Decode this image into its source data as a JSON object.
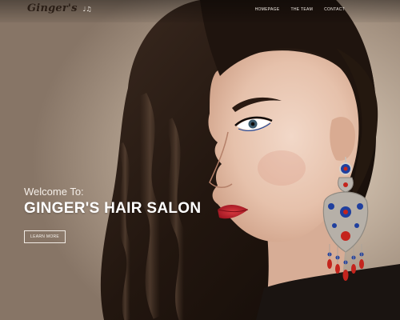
{
  "header": {
    "logo_text": "Ginger's",
    "logo_suffix": "♩♫"
  },
  "nav": {
    "items": [
      {
        "label": "HOMEPAGE"
      },
      {
        "label": "THE TEAM"
      },
      {
        "label": "CONTACT"
      }
    ]
  },
  "hero": {
    "welcome": "Welcome To:",
    "title": "GINGER'S HAIR SALON",
    "button_label": "LEARN MORE",
    "image_alt": "woman with long dark hair wearing an ornate jeweled earring"
  },
  "colors": {
    "background": "#c6b5a3",
    "hair": "#2a1b14",
    "skin": "#e8c7b3",
    "lips": "#b71f2a",
    "earring_blue": "#1f3f9e",
    "earring_red": "#c4241d",
    "earring_silver": "#b9b4ad"
  }
}
